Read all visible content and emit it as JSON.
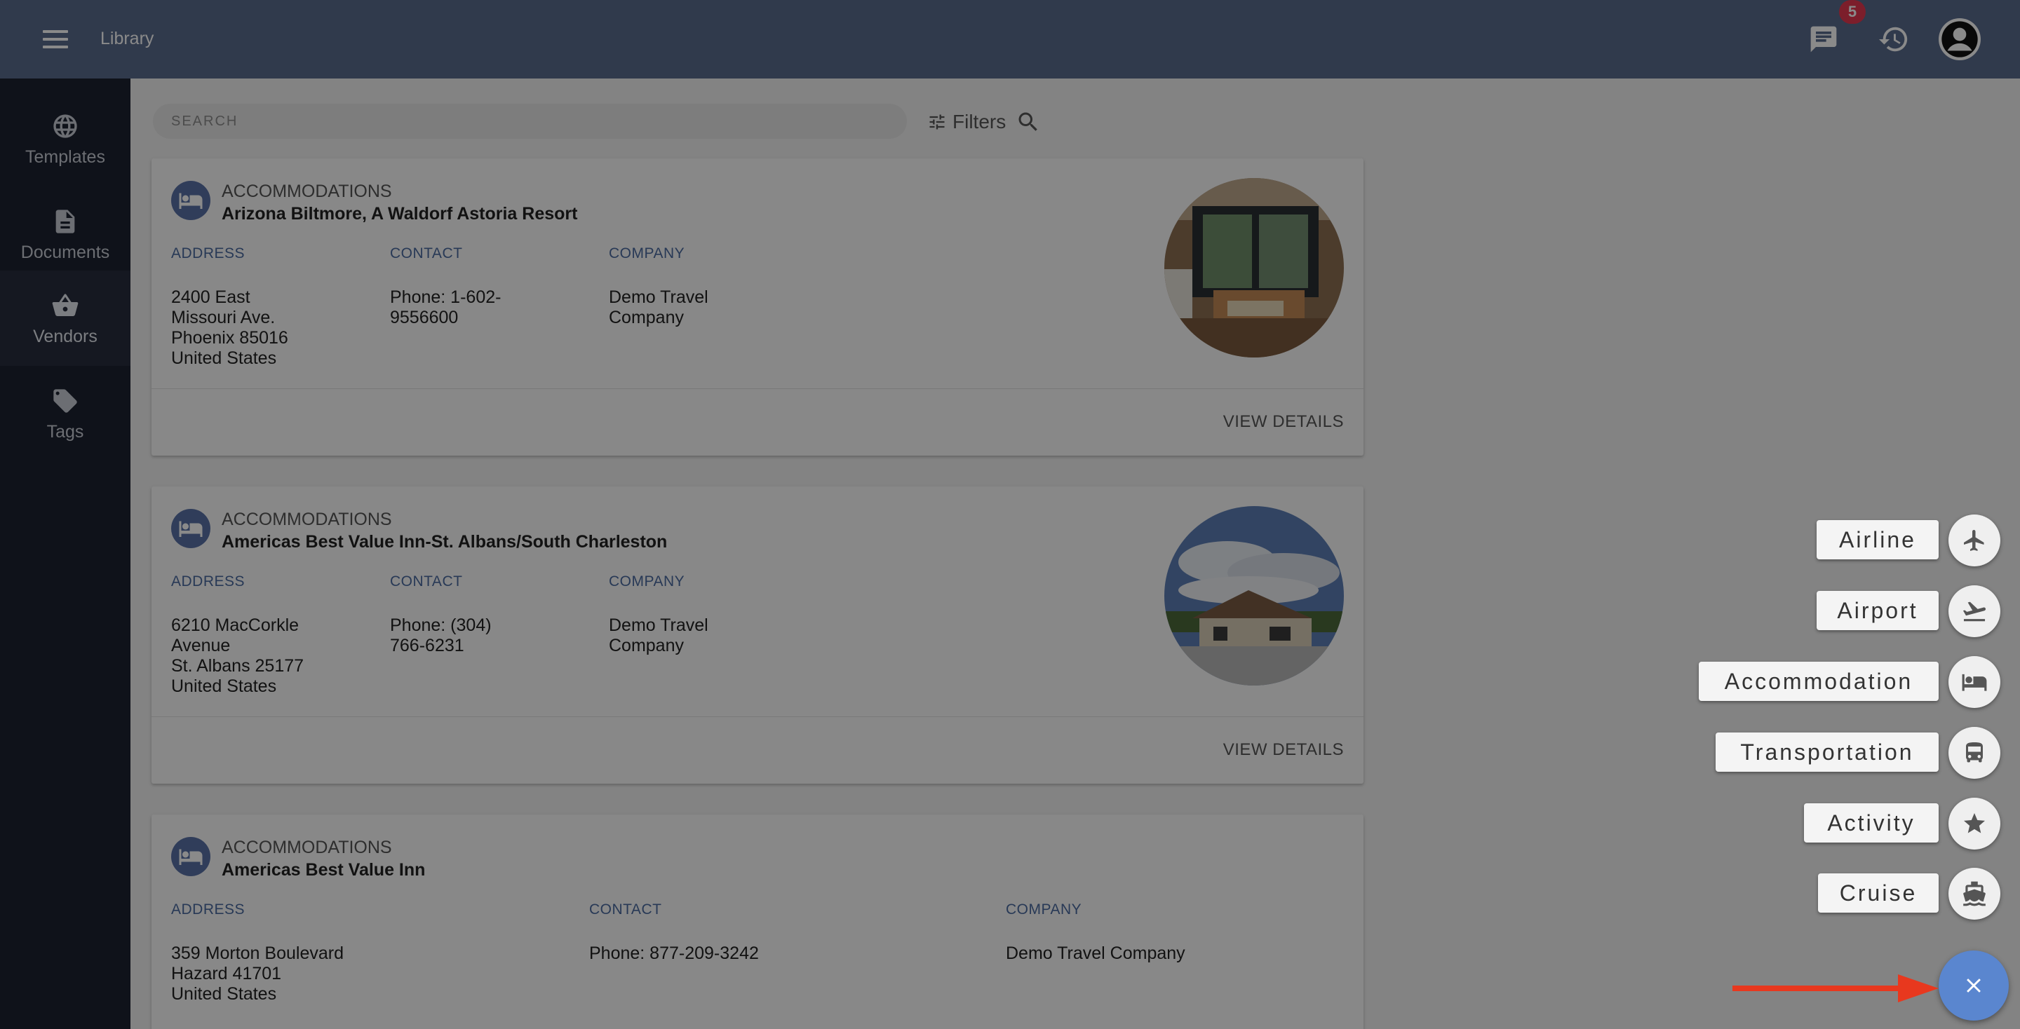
{
  "header": {
    "title": "Library",
    "notification_count": "5"
  },
  "sidebar": {
    "items": [
      {
        "label": "Templates",
        "icon": "globe-icon"
      },
      {
        "label": "Documents",
        "icon": "document-icon"
      },
      {
        "label": "Vendors",
        "icon": "basket-icon",
        "active": true
      },
      {
        "label": "Tags",
        "icon": "tag-icon"
      }
    ]
  },
  "search": {
    "placeholder": "SEARCH",
    "filters_label": "Filters"
  },
  "cards": [
    {
      "category": "ACCOMMODATIONS",
      "name": "Arizona Biltmore, A Waldorf Astoria Resort",
      "address_label": "ADDRESS",
      "address": "2400 East\nMissouri Ave.\nPhoenix 85016\nUnited States",
      "contact_label": "CONTACT",
      "contact": "Phone: 1-602-\n9556600",
      "company_label": "COMPANY",
      "company": "Demo Travel\nCompany",
      "action": "VIEW DETAILS"
    },
    {
      "category": "ACCOMMODATIONS",
      "name": "Americas Best Value Inn-St. Albans/South Charleston",
      "address_label": "ADDRESS",
      "address": "6210 MacCorkle\nAvenue\nSt. Albans 25177\nUnited States",
      "contact_label": "CONTACT",
      "contact": "Phone: (304)\n766-6231",
      "company_label": "COMPANY",
      "company": "Demo Travel\nCompany",
      "action": "VIEW DETAILS"
    },
    {
      "category": "ACCOMMODATIONS",
      "name": "Americas Best Value Inn",
      "address_label": "ADDRESS",
      "address": "359 Morton Boulevard\nHazard 41701\nUnited States",
      "contact_label": "CONTACT",
      "contact": "Phone: 877-209-3242",
      "company_label": "COMPANY",
      "company": "Demo Travel Company"
    }
  ],
  "speed_dial": {
    "items": [
      {
        "label": "Airline",
        "icon": "airplane-icon"
      },
      {
        "label": "Airport",
        "icon": "flight-takeoff-icon"
      },
      {
        "label": "Accommodation",
        "icon": "bed-icon"
      },
      {
        "label": "Transportation",
        "icon": "bus-icon"
      },
      {
        "label": "Activity",
        "icon": "star-icon"
      },
      {
        "label": "Cruise",
        "icon": "ship-icon"
      }
    ],
    "close_icon": "close-icon"
  },
  "colors": {
    "topbar": "#5a6b8c",
    "sidebar": "#1c2230",
    "accent": "#5a86cf",
    "badge": "#e53950",
    "arrow": "#e8381e"
  }
}
